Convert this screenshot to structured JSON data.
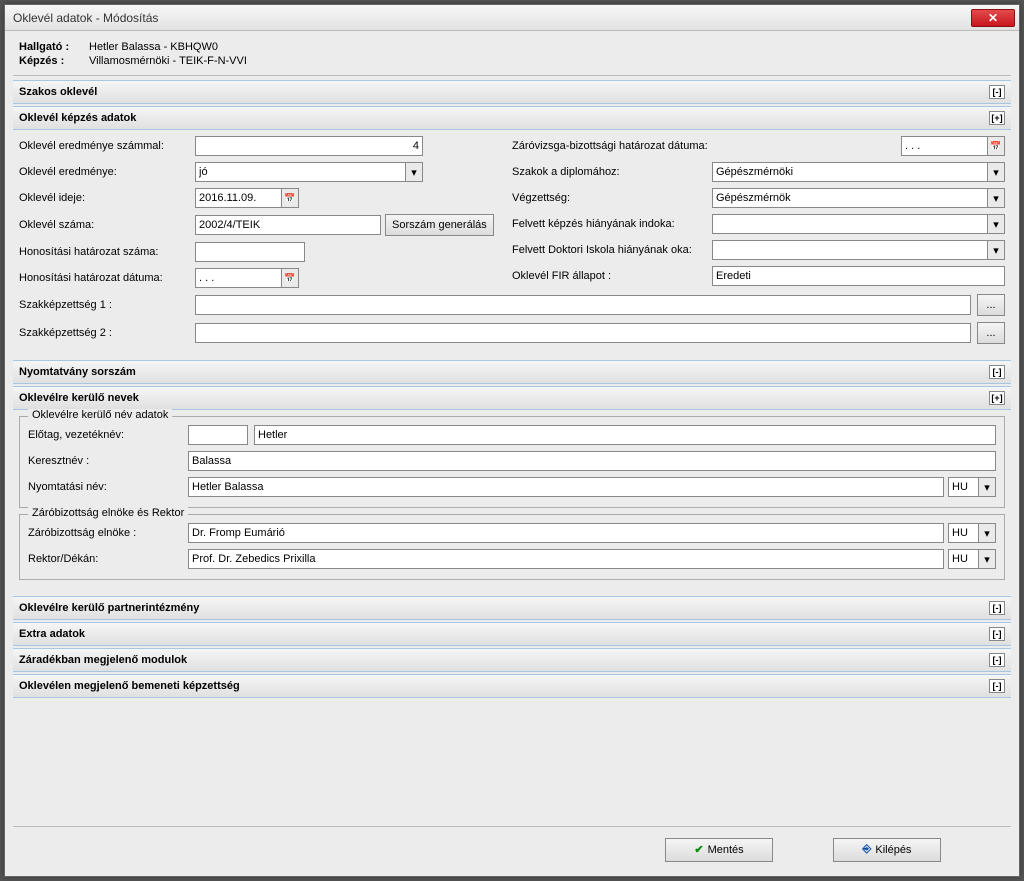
{
  "window": {
    "title": "Oklevél adatok - Módosítás"
  },
  "header": {
    "hallgato_lbl": "Hallgató :",
    "hallgato_val": "Hetler Balassa - KBHQW0",
    "kepzes_lbl": "Képzés :",
    "kepzes_val": "Villamosmérnöki - TEIK-F-N-VVI"
  },
  "sections": {
    "szakos": {
      "title": "Szakos oklevél",
      "toggle": "[-]"
    },
    "kepzes": {
      "title": "Oklevél képzés adatok",
      "toggle": "[+]"
    },
    "nyomt": {
      "title": "Nyomtatvány sorszám",
      "toggle": "[-]"
    },
    "nevek": {
      "title": "Oklevélre kerülő nevek",
      "toggle": "[+]"
    },
    "partner": {
      "title": "Oklevélre kerülő partnerintézmény",
      "toggle": "[-]"
    },
    "extra": {
      "title": "Extra adatok",
      "toggle": "[-]"
    },
    "zaradek": {
      "title": "Záradékban megjelenő modulok",
      "toggle": "[-]"
    },
    "bemeneti": {
      "title": "Oklevélen megjelenő bemeneti képzettség",
      "toggle": "[-]"
    }
  },
  "form": {
    "eredm_szammal_lbl": "Oklevél eredménye számmal:",
    "eredm_szammal_val": "4",
    "eredm_lbl": "Oklevél eredménye:",
    "eredm_val": "jó",
    "ideje_lbl": "Oklevél ideje:",
    "ideje_val": "2016.11.09.",
    "szama_lbl": "Oklevél száma:",
    "szama_val": "2002/4/TEIK",
    "sorszam_btn": "Sorszám generálás",
    "hon_szama_lbl": "Honosítási határozat száma:",
    "hon_szama_val": "",
    "hon_datum_lbl": "Honosítási határozat dátuma:",
    "hon_datum_val": ". . .",
    "szakkep1_lbl": "Szakképzettség 1 :",
    "szakkep1_val": "",
    "szakkep2_lbl": "Szakképzettség 2 :",
    "szakkep2_val": "",
    "zv_datum_lbl": "Záróvizsga-bizottsági határozat dátuma:",
    "zv_datum_val": ". . .",
    "szakok_lbl": "Szakok a diplomához:",
    "szakok_val": "Gépészmérnöki",
    "vegzettseg_lbl": "Végzettség:",
    "vegzettseg_val": "Gépészmérnök",
    "felvett_kepzes_lbl": "Felvett képzés hiányának indoka:",
    "felvett_kepzes_val": "",
    "felvett_doktori_lbl": "Felvett Doktori Iskola hiányának oka:",
    "felvett_doktori_val": "",
    "fir_lbl": "Oklevél FIR állapot :",
    "fir_val": "Eredeti",
    "dots_btn": "..."
  },
  "nevek": {
    "fieldset1_legend": "Oklevélre kerülő név adatok",
    "elotag_lbl": "Előtag, vezetéknév:",
    "elotag_val": "",
    "vezeteknev_val": "Hetler",
    "keresztnev_lbl": "Keresztnév :",
    "keresztnev_val": "Balassa",
    "nyomtatasi_lbl": "Nyomtatási név:",
    "nyomtatasi_val": "Hetler Balassa",
    "lang": "HU",
    "fieldset2_legend": "Záróbizottság elnöke és Rektor",
    "elnok_lbl": "Záróbizottság elnöke :",
    "elnok_val": "Dr. Fromp Eumárió",
    "rektor_lbl": "Rektor/Dékán:",
    "rektor_val": "Prof. Dr. Zebedics Prixilla"
  },
  "buttons": {
    "mentes": "Mentés",
    "kilepes": "Kilépés"
  }
}
